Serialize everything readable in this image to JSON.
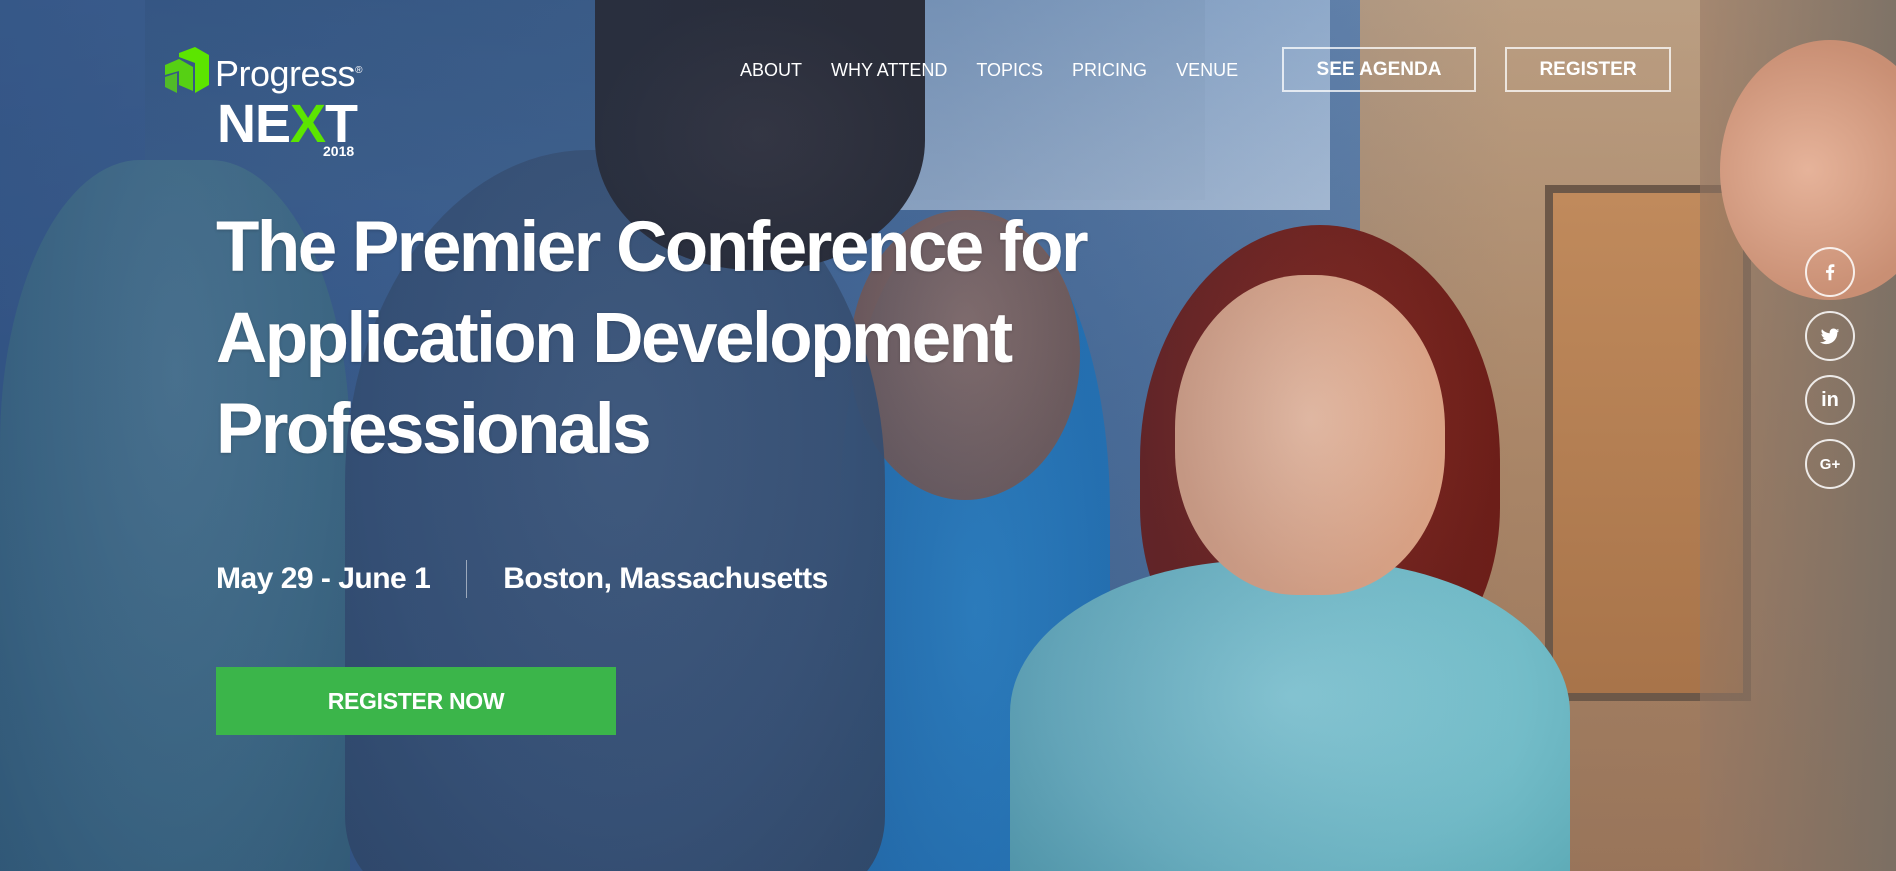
{
  "logo": {
    "brand": "Progress",
    "product_prefix": "NE",
    "product_x": "X",
    "product_suffix": "T",
    "year": "2018"
  },
  "nav": {
    "items": [
      "ABOUT",
      "WHY ATTEND",
      "TOPICS",
      "PRICING",
      "VENUE"
    ],
    "see_agenda": "SEE AGENDA",
    "register": "REGISTER"
  },
  "hero": {
    "headline_lines": [
      "The Premier Conference for",
      "Application Development",
      "Professionals"
    ],
    "dates": "May 29 - June 1",
    "location": "Boston, Massachusetts",
    "cta": "REGISTER NOW"
  },
  "social": {
    "icons": [
      "facebook-icon",
      "twitter-icon",
      "linkedin-icon",
      "google-plus-icon"
    ],
    "linkedin_text": "in",
    "google_plus_text": "G+"
  },
  "colors": {
    "accent_green": "#3bb54a",
    "logo_green": "#5ce500",
    "text": "#ffffff"
  }
}
